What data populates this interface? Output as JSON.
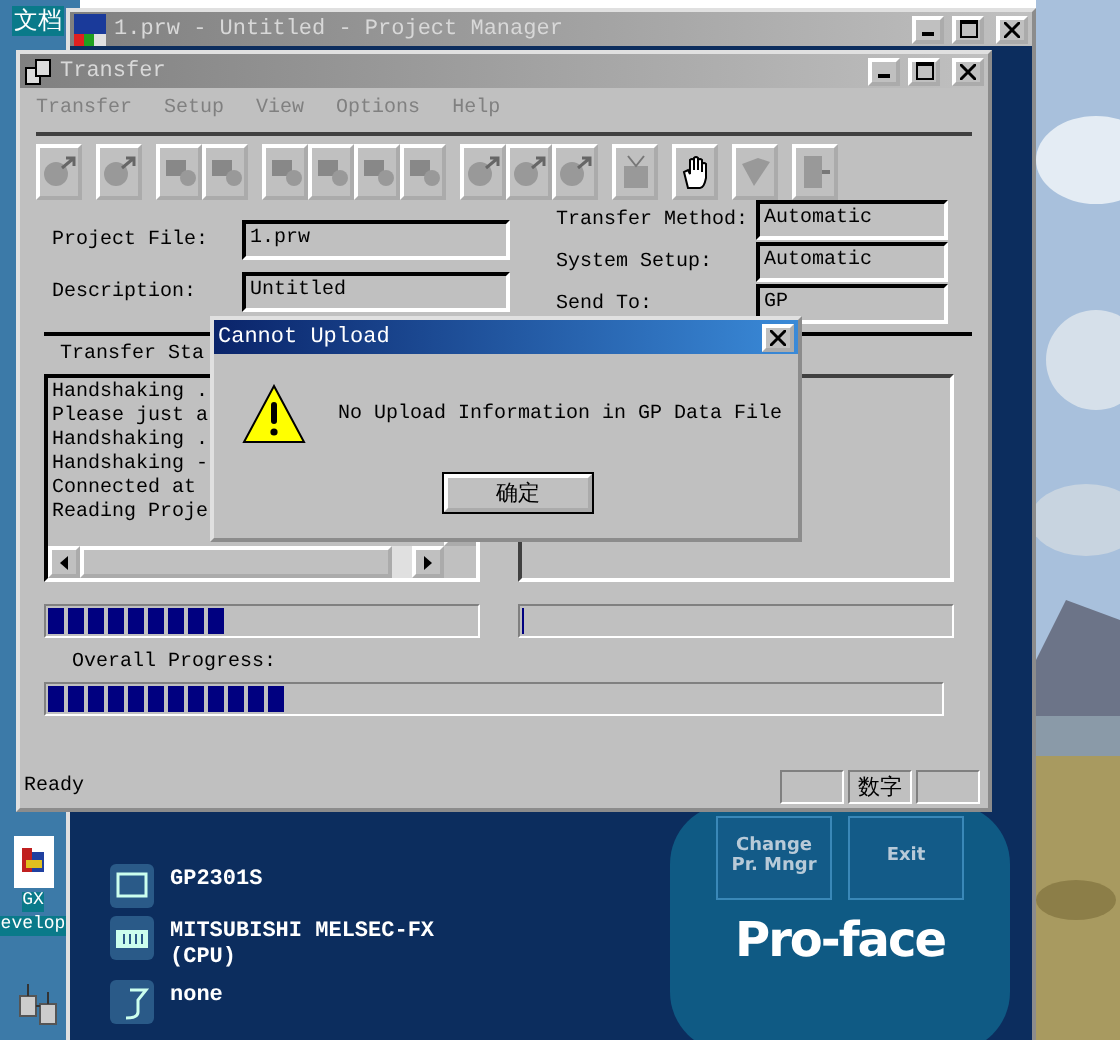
{
  "desktop": {
    "icons": [
      {
        "kind": "folder",
        "lines": [
          "文档"
        ]
      },
      {
        "kind": "gx",
        "lines": [
          "GX",
          "evelop"
        ]
      },
      {
        "kind": "plug"
      }
    ]
  },
  "project_manager": {
    "title": "1.prw - Untitled - Project Manager",
    "info": [
      {
        "kind": "display",
        "text": "GP2301S"
      },
      {
        "kind": "plc",
        "text": "MITSUBISHI MELSEC-FX (CPU)"
      },
      {
        "kind": "cable",
        "text": "none"
      }
    ],
    "buttons": [
      "Change Pr. Mngr",
      "Exit"
    ],
    "logo": "Pro-face"
  },
  "transfer": {
    "title": "Transfer",
    "menu": [
      "Transfer",
      "Setup",
      "View",
      "Options",
      "Help"
    ],
    "toolbar": [
      [
        {
          "disabled": true
        }
      ],
      [
        {
          "disabled": true
        }
      ],
      [
        {
          "disabled": true
        },
        {
          "disabled": true
        }
      ],
      [
        {
          "disabled": true
        },
        {
          "disabled": true
        },
        {
          "disabled": true
        },
        {
          "disabled": true
        }
      ],
      [
        {
          "disabled": true
        },
        {
          "disabled": true
        },
        {
          "disabled": true
        }
      ],
      [
        {
          "disabled": true
        }
      ],
      [
        {
          "disabled": false
        }
      ],
      [
        {
          "disabled": true
        }
      ],
      [
        {
          "disabled": true
        }
      ]
    ],
    "fields_left": [
      {
        "label": "Project File:",
        "value": "1.prw"
      },
      {
        "label": "Description:",
        "value": "Untitled"
      }
    ],
    "fields_right": [
      {
        "label": "Transfer Method:",
        "value": "Automatic"
      },
      {
        "label": "System Setup:",
        "value": "Automatic"
      },
      {
        "label": "Send To:",
        "value": "GP"
      }
    ],
    "status_label": "Transfer Sta",
    "log": [
      "Handshaking .",
      "Please just a",
      "Handshaking .",
      "Handshaking -",
      "Connected at",
      "Reading Proje"
    ],
    "progress_left": {
      "level": 0.41
    },
    "progress_right": {
      "level": 0
    },
    "overall_label": "Overall Progress:",
    "overall": {
      "level": 0.27
    },
    "status_bar": {
      "text": "Ready",
      "indicators": [
        "数字"
      ]
    }
  },
  "dialog": {
    "title": "Cannot Upload",
    "message": "No Upload Information in GP Data File",
    "button": "确定"
  }
}
